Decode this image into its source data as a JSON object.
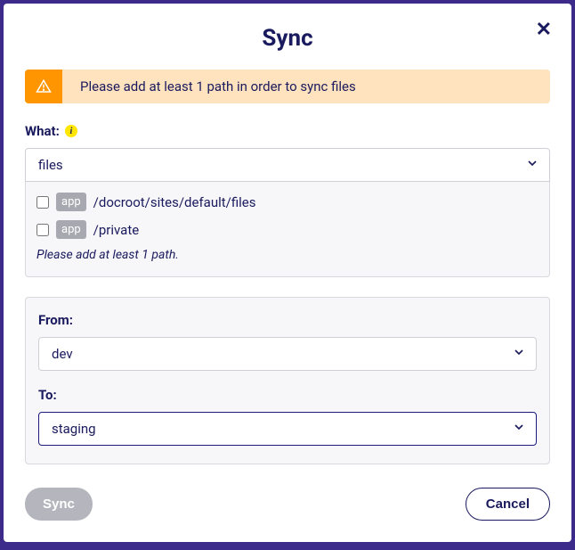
{
  "modal": {
    "title": "Sync",
    "close_label": "✕"
  },
  "alert": {
    "message": "Please add at least 1 path in order to sync files"
  },
  "what": {
    "label": "What:",
    "info": "i",
    "selected": "files",
    "paths": [
      {
        "badge": "app",
        "path": "/docroot/sites/default/files",
        "checked": false
      },
      {
        "badge": "app",
        "path": "/private",
        "checked": false
      }
    ],
    "hint": "Please add at least 1 path."
  },
  "from": {
    "label": "From:",
    "selected": "dev"
  },
  "to": {
    "label": "To:",
    "selected": "staging"
  },
  "footer": {
    "sync_label": "Sync",
    "cancel_label": "Cancel"
  }
}
